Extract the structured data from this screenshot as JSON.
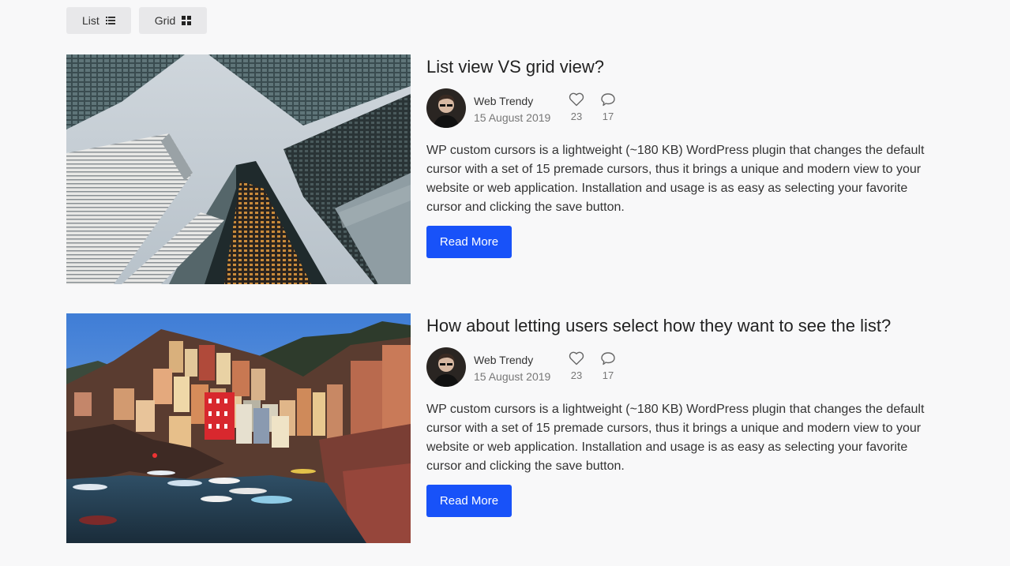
{
  "toolbar": {
    "list_label": "List",
    "grid_label": "Grid"
  },
  "posts": [
    {
      "title": "List view VS grid view?",
      "author": "Web Trendy",
      "date": "15 August 2019",
      "likes": "23",
      "comments": "17",
      "excerpt": "WP custom cursors is a lightweight (~180 KB) WordPress plugin that changes the default cursor with a set of 15 premade cursors, thus it brings a unique and modern view to your website or web application. Installation and usage is as easy as selecting your favorite cursor and clicking the save button.",
      "read_more": "Read More"
    },
    {
      "title": "How about letting users select how they want to see the list?",
      "author": "Web Trendy",
      "date": "15 August 2019",
      "likes": "23",
      "comments": "17",
      "excerpt": "WP custom cursors is a lightweight (~180 KB) WordPress plugin that changes the default cursor with a set of 15 premade cursors, thus it brings a unique and modern view to your website or web application. Installation and usage is as easy as selecting your favorite cursor and clicking the save button.",
      "read_more": "Read More"
    }
  ],
  "icons": {
    "list": "list-icon",
    "grid": "grid-icon",
    "like": "heart-icon",
    "comment": "comment-icon"
  },
  "colors": {
    "accent": "#1852f9",
    "background": "#f8f8f9",
    "toggle_bg": "#e8e8ea"
  }
}
